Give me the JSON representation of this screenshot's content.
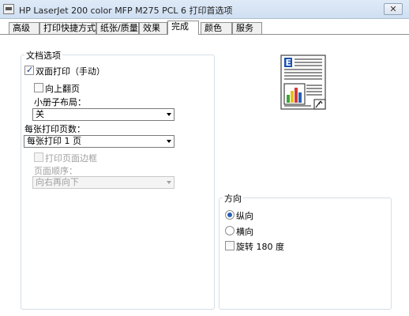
{
  "window": {
    "title": "HP LaserJet 200 color MFP M275 PCL 6 打印首选项",
    "close_label": "✕"
  },
  "tabs": [
    {
      "label": "高级"
    },
    {
      "label": "打印快捷方式"
    },
    {
      "label": "纸张/质量"
    },
    {
      "label": "效果"
    },
    {
      "label": "完成",
      "active": true
    },
    {
      "label": "颜色"
    },
    {
      "label": "服务"
    }
  ],
  "doc_options": {
    "title": "文档选项",
    "duplex": {
      "label": "双面打印（手动）",
      "checked": true
    },
    "flip_up": {
      "label": "向上翻页",
      "checked": false
    },
    "booklet_label": "小册子布局：",
    "booklet_value": "关",
    "pages_per_sheet_label": "每张打印页数：",
    "pages_per_sheet_value": "每张打印 1 页",
    "print_borders": {
      "label": "打印页面边框",
      "checked": false,
      "disabled": true
    },
    "page_order_label": "页面顺序：",
    "page_order_value": "向右再向下"
  },
  "orientation": {
    "title": "方向",
    "portrait": {
      "label": "纵向",
      "checked": true
    },
    "landscape": {
      "label": "横向",
      "checked": false
    },
    "rotate": {
      "label": "旋转 180 度",
      "checked": false
    }
  },
  "colors": {
    "accent_blue": "#2a5fb8",
    "group_border": "#d5dfe5",
    "disabled_text": "#a0a0a0"
  }
}
